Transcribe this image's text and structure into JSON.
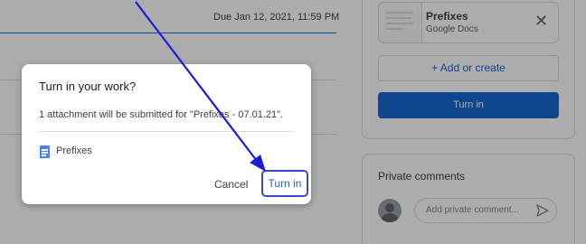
{
  "background": {
    "due": "Due Jan 12, 2021, 11:59 PM",
    "attachment": {
      "title": "Prefixes",
      "subtitle": "Google Docs",
      "close": "✕"
    },
    "add_or_create": "+ Add or create",
    "turn_in": "Turn in",
    "private_comments": {
      "title": "Private comments",
      "placeholder": "Add private comment..."
    }
  },
  "dialog": {
    "title": "Turn in your work?",
    "message": "1 attachment will be submitted for \"Prefixes - 07.01.21\".",
    "file": "Prefixes",
    "cancel": "Cancel",
    "turn_in": "Turn in"
  },
  "colors": {
    "accent": "#1967d2",
    "annotation": "#1a1ad8",
    "highlight": "#3949c9"
  },
  "icons": {
    "doc": "google-docs-icon",
    "send": "send-icon",
    "close": "close-icon"
  }
}
